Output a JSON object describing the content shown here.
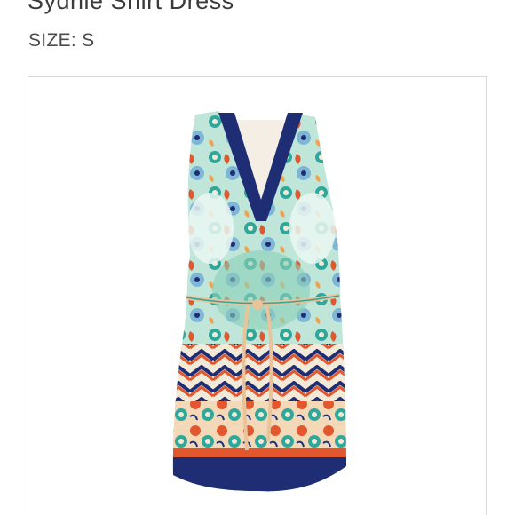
{
  "product": {
    "title": "Sydnie Shirt Dress",
    "size_text": "SIZE: S"
  },
  "image": {
    "subject": "dress-photo",
    "colors": {
      "navy": "#1f2e74",
      "teal": "#2fa79a",
      "mint": "#9fd8c4",
      "orange": "#e2572e",
      "cream": "#f2ead8",
      "sky": "#7fb6d6"
    }
  }
}
